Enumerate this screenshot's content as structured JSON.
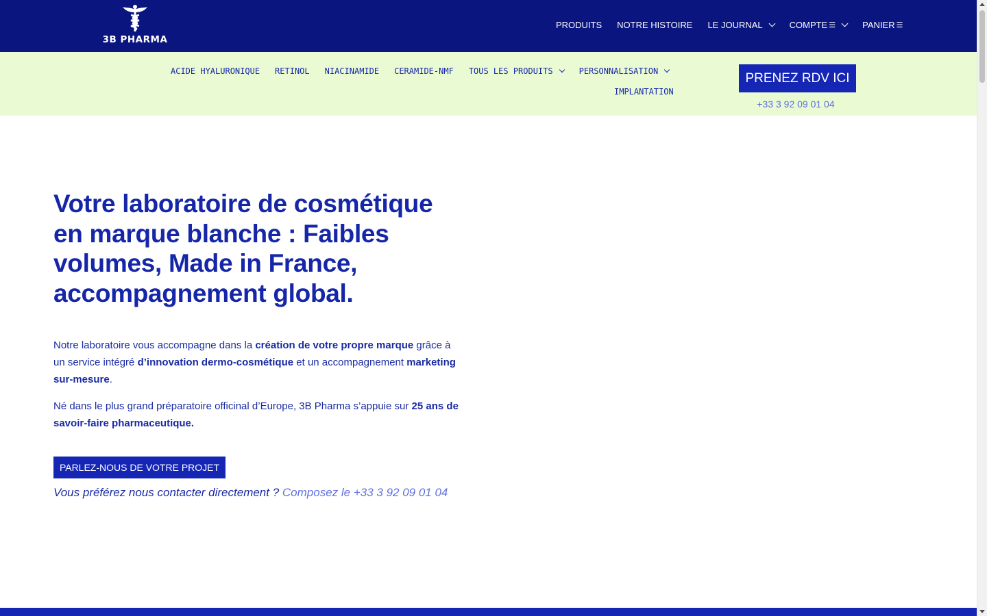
{
  "brand": {
    "name": "3B PHARMA",
    "logo_icon": "caduceus-icon"
  },
  "top_nav": {
    "items": [
      {
        "label": "PRODUITS"
      },
      {
        "label": "NOTRE HISTOIRE"
      },
      {
        "label": "LE JOURNAL"
      },
      {
        "label": "COMPTE"
      },
      {
        "label": "PANIER"
      }
    ],
    "menu_glyph": "☰"
  },
  "sub_nav": {
    "items": [
      {
        "label": "ACIDE HYALURONIQUE"
      },
      {
        "label": "RETINOL"
      },
      {
        "label": "NIACINAMIDE"
      },
      {
        "label": "CERAMIDE-NMF"
      },
      {
        "label": "TOUS LES PRODUITS"
      },
      {
        "label": "PERSONNALISATION"
      },
      {
        "label": "IMPLANTATION"
      }
    ],
    "rdv_button": "PRENEZ RDV ICI",
    "phone": "+33 3 92 09 01 04"
  },
  "hero": {
    "title": "Votre laboratoire de cosmétique en marque blanche : Faibles volumes, Made in France, accompagnement global.",
    "p1": {
      "t1": "Notre laboratoire vous accompagne dans la ",
      "b1": "création de votre propre marque",
      "t2": " grâce à un service intégré ",
      "b2": "d’innovation dermo-cosmétique",
      "t3": " et un accompagnement ",
      "b3": "marketing sur-mesure",
      "t4": "."
    },
    "p2": {
      "t1": "Né dans le plus grand préparatoire officinal d’Europe, 3B Pharma s’appuie sur ",
      "b1": "25 ans de savoir-faire pharmaceutique."
    },
    "cta": "PARLEZ-NOUS DE VOTRE PROJET",
    "contact_text": "Vous préférez nous contacter directement ? ",
    "contact_link": "Composez le +33 3 92 09 01 04"
  },
  "colors": {
    "navy": "#0b1580",
    "blue": "#1526b5",
    "text_blue": "#1526a8",
    "light_green": "#eafbd4",
    "link_blue": "#6071e0"
  }
}
